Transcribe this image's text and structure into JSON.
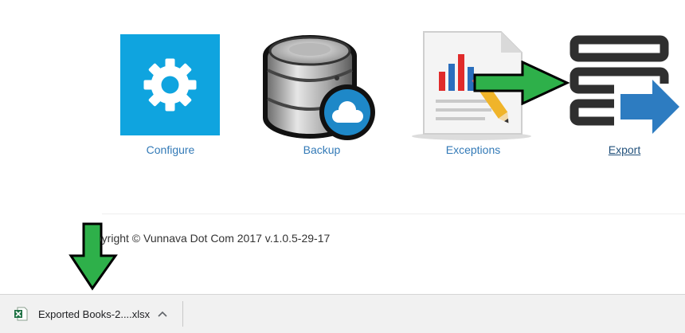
{
  "tiles": [
    {
      "label": "Configure",
      "icon": "gear-icon",
      "color": "#0fa4df"
    },
    {
      "label": "Backup",
      "icon": "database-cloud-icon",
      "color": "#1e88c8"
    },
    {
      "label": "Exceptions",
      "icon": "report-chart-icon",
      "color": "#e02b2b"
    },
    {
      "label": "Export",
      "icon": "export-icon",
      "color": "#2d7cc1"
    }
  ],
  "footer": {
    "text": "Copyright © Vunnava Dot Com 2017 v.1.0.5-29-17"
  },
  "download_bar": {
    "file_name": "Exported Books-2....xlsx",
    "file_icon": "excel-file-icon",
    "caret_icon": "chevron-up-icon"
  },
  "overlay_arrow_color": "#2eb04a"
}
